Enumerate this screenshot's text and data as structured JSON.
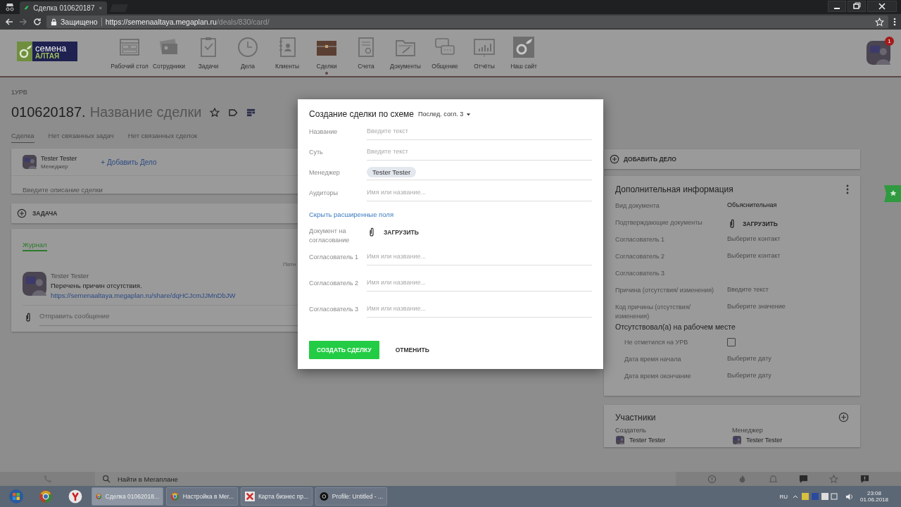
{
  "browser": {
    "tab_title": "Сделка 010620187",
    "security": "Защищено",
    "url_host": "https://semenaaltaya.megaplan.ru",
    "url_path": "/deals/830/card/"
  },
  "header": {
    "logo": {
      "line1": "семена",
      "line2": "АЛТАЯ"
    },
    "nav": [
      {
        "label": "Рабочий стол",
        "selected": false
      },
      {
        "label": "Сотрудники",
        "selected": false
      },
      {
        "label": "Задачи",
        "selected": false
      },
      {
        "label": "Дела",
        "selected": false
      },
      {
        "label": "Клиенты",
        "selected": false
      },
      {
        "label": "Сделки",
        "selected": true
      },
      {
        "label": "Счета",
        "selected": false
      },
      {
        "label": "Документы",
        "selected": false
      },
      {
        "label": "Общение",
        "selected": false
      },
      {
        "label": "Отчёты",
        "selected": false
      },
      {
        "label": "Наш сайт",
        "selected": false
      }
    ],
    "avatar_badge": "1"
  },
  "deal": {
    "breadcrumb": "1УРВ",
    "number": "010620187.",
    "name": "Название сделки",
    "tabs": [
      {
        "label": "Сделка",
        "selected": true
      },
      {
        "label": "Нет связанных задач",
        "selected": false
      },
      {
        "label": "Нет связанных сделок",
        "selected": false
      }
    ],
    "manager": {
      "name": "Tester Tester",
      "role": "Менеджер"
    },
    "add_action": "+ Добавить Дело",
    "description_placeholder": "Введите описание сделки",
    "task_button": "ЗАДАЧА",
    "journal": {
      "tabs": [
        {
          "label": "Журнал",
          "selected": true
        }
      ],
      "date": "Пятн",
      "message": {
        "author": "Tester Tester",
        "text": "Перечень причин отсутствия.",
        "link": "https://semenaaltaya.megaplan.ru/share/dqHCJcmJJMnDbJW"
      },
      "compose_placeholder": "Отправить сообщение"
    }
  },
  "sidebar": {
    "add_action": "ДОБАВИТЬ ДЕЛО",
    "info": {
      "title": "Дополнительная информация",
      "rows": [
        {
          "kind": "value",
          "label": "Вид документа",
          "value": "Объяснительная"
        },
        {
          "kind": "upload",
          "label": "Подтверждающие документы",
          "value": "ЗАГРУЗИТЬ"
        },
        {
          "kind": "input",
          "label": "Согласователь 1",
          "placeholder": "Выберите контакт"
        },
        {
          "kind": "input",
          "label": "Согласователь 2",
          "placeholder": "Выберите контакт"
        },
        {
          "kind": "empty",
          "label": "Согласователь 3"
        },
        {
          "kind": "input",
          "label": "Причина (отсутствия/ изменения)",
          "placeholder": "Введите текст"
        },
        {
          "kind": "input",
          "label": "Код причины (отсутствия/ изменения)",
          "placeholder": "Выберите значение"
        },
        {
          "kind": "section",
          "label": "Отсутствовал(а) на рабочем месте",
          "children": [
            {
              "kind": "checkbox",
              "label": "Не отметился на УРВ",
              "checked": false
            },
            {
              "kind": "input",
              "label": "Дата время начала",
              "placeholder": "Выберите дату"
            },
            {
              "kind": "input",
              "label": "Дата время окончание",
              "placeholder": "Выберите дату"
            }
          ]
        }
      ]
    },
    "participants": {
      "title": "Участники",
      "columns": [
        {
          "role": "Создатель",
          "name": "Tester Tester"
        },
        {
          "role": "Менеджер",
          "name": "Tester Tester"
        }
      ]
    }
  },
  "modal": {
    "title": "Создание сделки по схеме",
    "scheme": "Послед. согл. 3",
    "fields": [
      {
        "kind": "input",
        "label": "Название",
        "placeholder": "Введите текст"
      },
      {
        "kind": "input",
        "label": "Суть",
        "placeholder": "Введите текст"
      },
      {
        "kind": "chip",
        "label": "Менеджер",
        "value": "Tester Tester"
      },
      {
        "kind": "input",
        "label": "Аудиторы",
        "placeholder": "Имя или название..."
      },
      {
        "kind": "link",
        "label": "Скрыть расширенные поля"
      },
      {
        "kind": "upload",
        "label": "Документ на согласование",
        "value": "ЗАГРУЗИТЬ"
      },
      {
        "kind": "input",
        "label": "Согласователь 1",
        "placeholder": "Имя или название..."
      },
      {
        "kind": "input",
        "label": "Согласователь 2",
        "placeholder": "Имя или название..."
      },
      {
        "kind": "input",
        "label": "Согласователь 3",
        "placeholder": "Имя или название..."
      }
    ],
    "buttons": [
      {
        "label": "СОЗДАТЬ СДЕЛКУ",
        "kind": "primary"
      },
      {
        "label": "ОТМЕНИТЬ",
        "kind": "flat"
      }
    ]
  },
  "bottom_bar": {
    "search_placeholder": "Найти в Мегаплане"
  },
  "taskbar": {
    "tasks": [
      {
        "label": "Сделка 01062018...",
        "selected": true
      },
      {
        "label": "Настройка в Мег...",
        "selected": false
      },
      {
        "label": "Карта бизнес пр...",
        "selected": false
      },
      {
        "label": "Profile: Untitled - ...",
        "selected": false
      }
    ],
    "language": "RU",
    "time": "23:08",
    "date": "01.06.2018"
  }
}
